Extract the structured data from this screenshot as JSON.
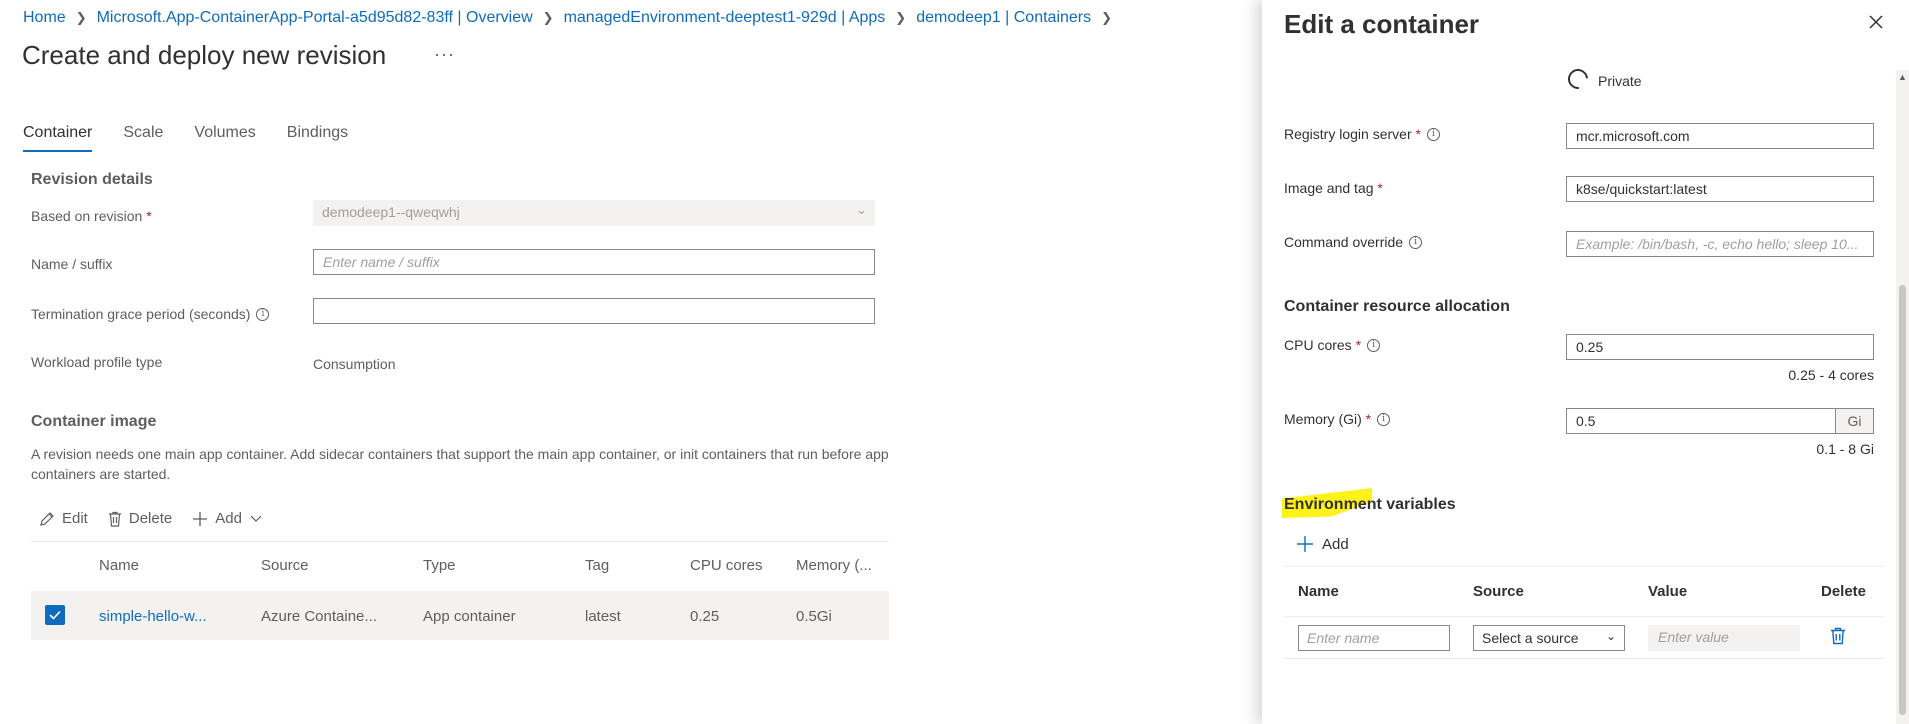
{
  "breadcrumb": {
    "items": [
      "Home",
      "Microsoft.App-ContainerApp-Portal-a5d95d82-83ff | Overview",
      "managedEnvironment-deeptest1-929d | Apps",
      "demodeep1 | Containers"
    ]
  },
  "page": {
    "title": "Create and deploy new revision",
    "more": "···"
  },
  "tabs": [
    "Container",
    "Scale",
    "Volumes",
    "Bindings"
  ],
  "revision": {
    "heading": "Revision details",
    "based_on_label": "Based on revision",
    "based_on_value": "demodeep1--qweqwhj",
    "name_label": "Name / suffix",
    "name_placeholder": "Enter name / suffix",
    "grace_label": "Termination grace period (seconds)",
    "workload_label": "Workload profile type",
    "workload_value": "Consumption"
  },
  "container_image": {
    "heading": "Container image",
    "description": "A revision needs one main app container. Add sidecar containers that support the main app container, or init containers that run before app containers are started.",
    "commands": {
      "edit": "Edit",
      "delete": "Delete",
      "add": "Add"
    },
    "columns": [
      "Name",
      "Source",
      "Type",
      "Tag",
      "CPU cores",
      "Memory (..."
    ],
    "rows": [
      {
        "name": "simple-hello-w...",
        "source": "Azure Containe...",
        "type": "App container",
        "tag": "latest",
        "cpu": "0.25",
        "memory": "0.5Gi"
      }
    ]
  },
  "panel": {
    "title": "Edit a container",
    "private_label": "Private",
    "registry_label": "Registry login server",
    "registry_value": "mcr.microsoft.com",
    "image_label": "Image and tag",
    "image_value": "k8se/quickstart:latest",
    "command_label": "Command override",
    "command_placeholder": "Example: /bin/bash, -c, echo hello; sleep 10...",
    "resource_heading": "Container resource allocation",
    "cpu_label": "CPU cores",
    "cpu_value": "0.25",
    "cpu_hint": "0.25 - 4 cores",
    "memory_label": "Memory (Gi)",
    "memory_value": "0.5",
    "memory_suffix": "Gi",
    "memory_hint": "0.1 - 8 Gi",
    "env_heading": "Environment variables",
    "env_add": "Add",
    "env_columns": [
      "Name",
      "Source",
      "Value",
      "Delete"
    ],
    "env_name_placeholder": "Enter name",
    "env_source_placeholder": "Select a source",
    "env_value_placeholder": "Enter value"
  },
  "colors": {
    "accent": "#0f6cbd",
    "highlight": "#fff100",
    "required": "#a4262c"
  },
  "icons": [
    "chevron-right-icon",
    "ellipsis-icon",
    "chevron-down-icon",
    "info-icon",
    "edit-icon",
    "trash-icon",
    "plus-icon",
    "checkbox-checked-icon",
    "close-icon",
    "radio-icon"
  ]
}
